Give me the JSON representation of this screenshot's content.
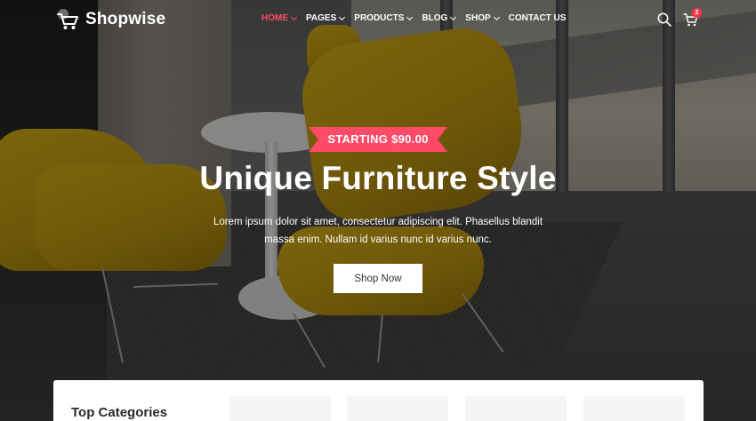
{
  "brand": {
    "name": "Shopwise"
  },
  "nav": {
    "items": [
      {
        "label": "HOME",
        "active": true,
        "has_dropdown": true
      },
      {
        "label": "PAGES",
        "active": false,
        "has_dropdown": true
      },
      {
        "label": "PRODUCTS",
        "active": false,
        "has_dropdown": true
      },
      {
        "label": "BLOG",
        "active": false,
        "has_dropdown": true
      },
      {
        "label": "SHOP",
        "active": false,
        "has_dropdown": true
      },
      {
        "label": "CONTACT US",
        "active": false,
        "has_dropdown": false
      }
    ]
  },
  "header_icons": {
    "search": "search-icon",
    "cart": "cart-icon",
    "cart_count": "2"
  },
  "hero": {
    "ribbon": "STARTING $90.00",
    "title": "Unique Furniture Style",
    "description": "Lorem ipsum dolor sit amet, consectetur adipiscing elit. Phasellus blandit massa enim. Nullam id varius nunc id varius nunc.",
    "button": "Shop Now"
  },
  "categories": {
    "title": "Top Categories"
  },
  "colors": {
    "accent": "#ff4a68",
    "active_nav": "#ff4b6a",
    "badge": "#ff324d",
    "text_light": "#ffffff",
    "text_dark": "#292b2c"
  }
}
